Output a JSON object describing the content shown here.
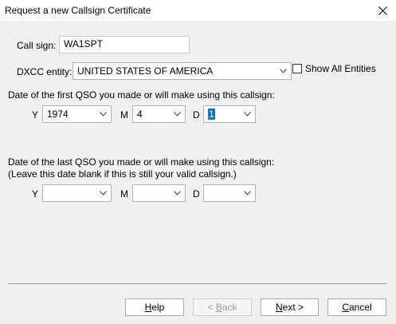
{
  "window": {
    "title": "Request a new Callsign Certificate"
  },
  "callsign": {
    "label": "Call sign:",
    "value": "WA1SPT"
  },
  "dxcc": {
    "label": "DXCC entity:",
    "value": "UNITED STATES OF AMERICA",
    "show_all_label": "Show All Entities"
  },
  "first_qso": {
    "heading": "Date of the first QSO you made or will make using this callsign:",
    "y_label": "Y",
    "y_value": "1974",
    "m_label": "M",
    "m_value": "4",
    "d_label": "D",
    "d_value": "1"
  },
  "last_qso": {
    "heading": "Date of the last QSO you made or will make using this callsign:",
    "note": "(Leave this date blank if this is still your valid callsign.)",
    "y_label": "Y",
    "y_value": "",
    "m_label": "M",
    "m_value": "",
    "d_label": "D",
    "d_value": ""
  },
  "buttons": {
    "help_u": "H",
    "help_rest": "elp",
    "back_pre": "< ",
    "back_u": "B",
    "back_rest": "ack",
    "next_u": "N",
    "next_rest": "ext >",
    "cancel_u": "C",
    "cancel_rest": "ancel"
  }
}
